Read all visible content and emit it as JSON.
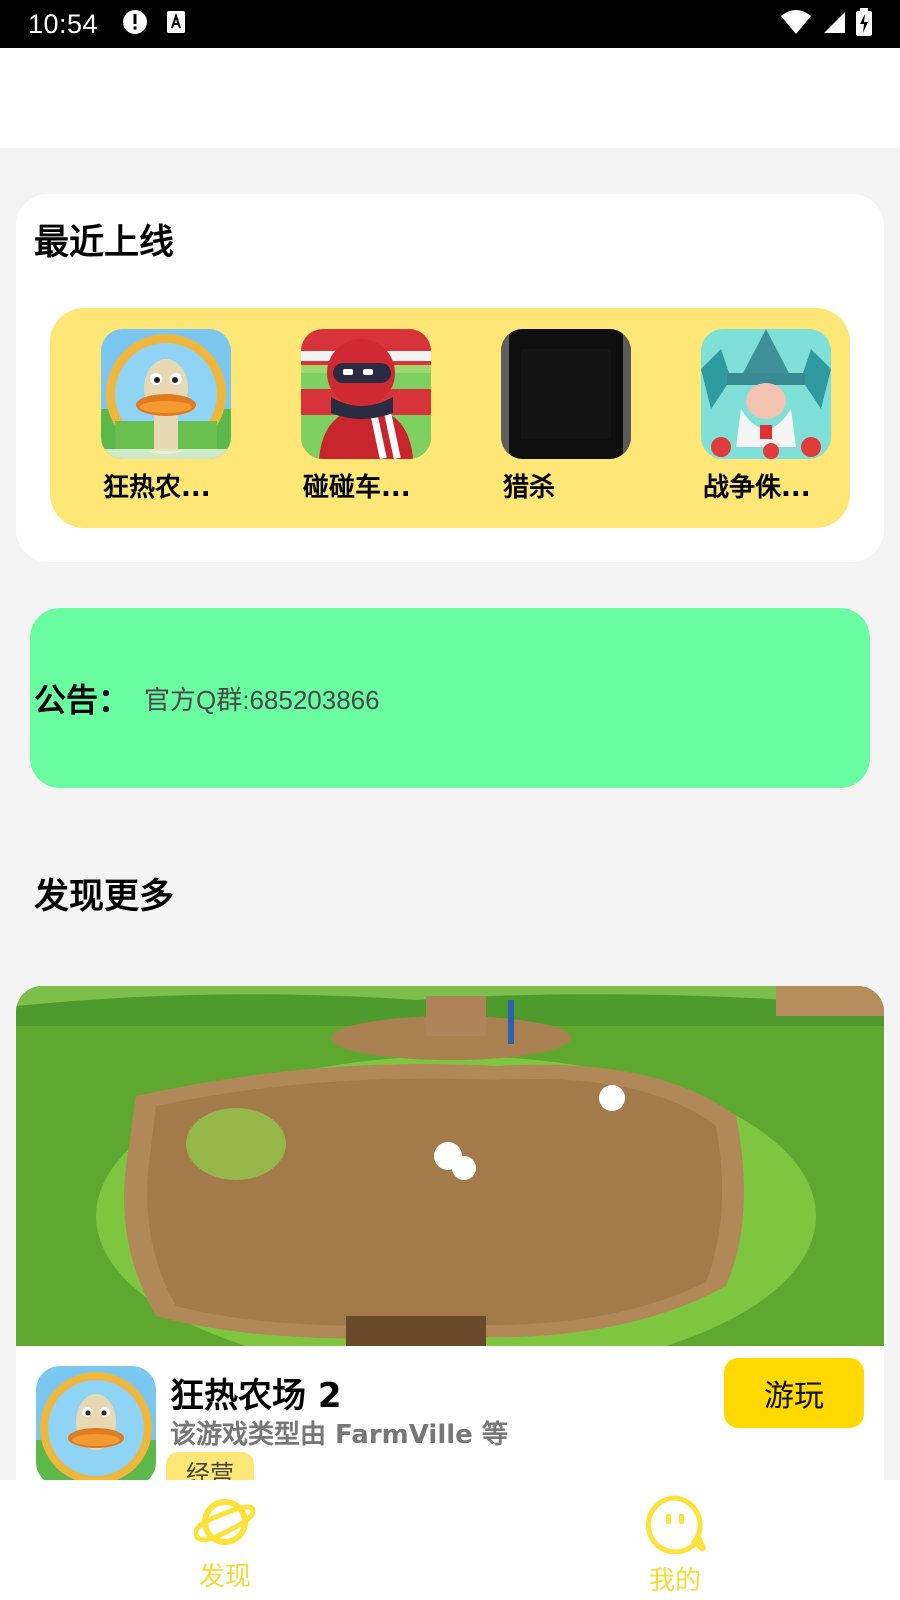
{
  "status_bar": {
    "time": "10:54",
    "icons": [
      "alert-icon",
      "sim-a-icon",
      "wifi-icon",
      "signal-icon",
      "battery-charging-icon"
    ]
  },
  "recent": {
    "title": "最近上线",
    "items": [
      {
        "label": "狂热农...",
        "icon": "ostrich-game-icon"
      },
      {
        "label": "碰碰车...",
        "icon": "racer-game-icon"
      },
      {
        "label": "猎杀",
        "icon": "dark-game-icon"
      },
      {
        "label": "战争侏...",
        "icon": "wizard-game-icon"
      }
    ]
  },
  "notice": {
    "label": "公告：",
    "text": "官方Q群:685203866"
  },
  "discover": {
    "title": "发现更多",
    "game": {
      "title": "狂热农场 2",
      "description": "该游戏类型由 FarmVille 等",
      "tag": "经营",
      "play_label": "游玩"
    }
  },
  "bottom_nav": {
    "items": [
      {
        "label": "发现",
        "icon": "planet-icon"
      },
      {
        "label": "我的",
        "icon": "face-bubble-icon"
      }
    ]
  },
  "colors": {
    "accent_yellow": "#ffd900",
    "strip_yellow": "#fee776",
    "notice_green": "#6afca0",
    "nav_yellow": "#f7dc36"
  }
}
